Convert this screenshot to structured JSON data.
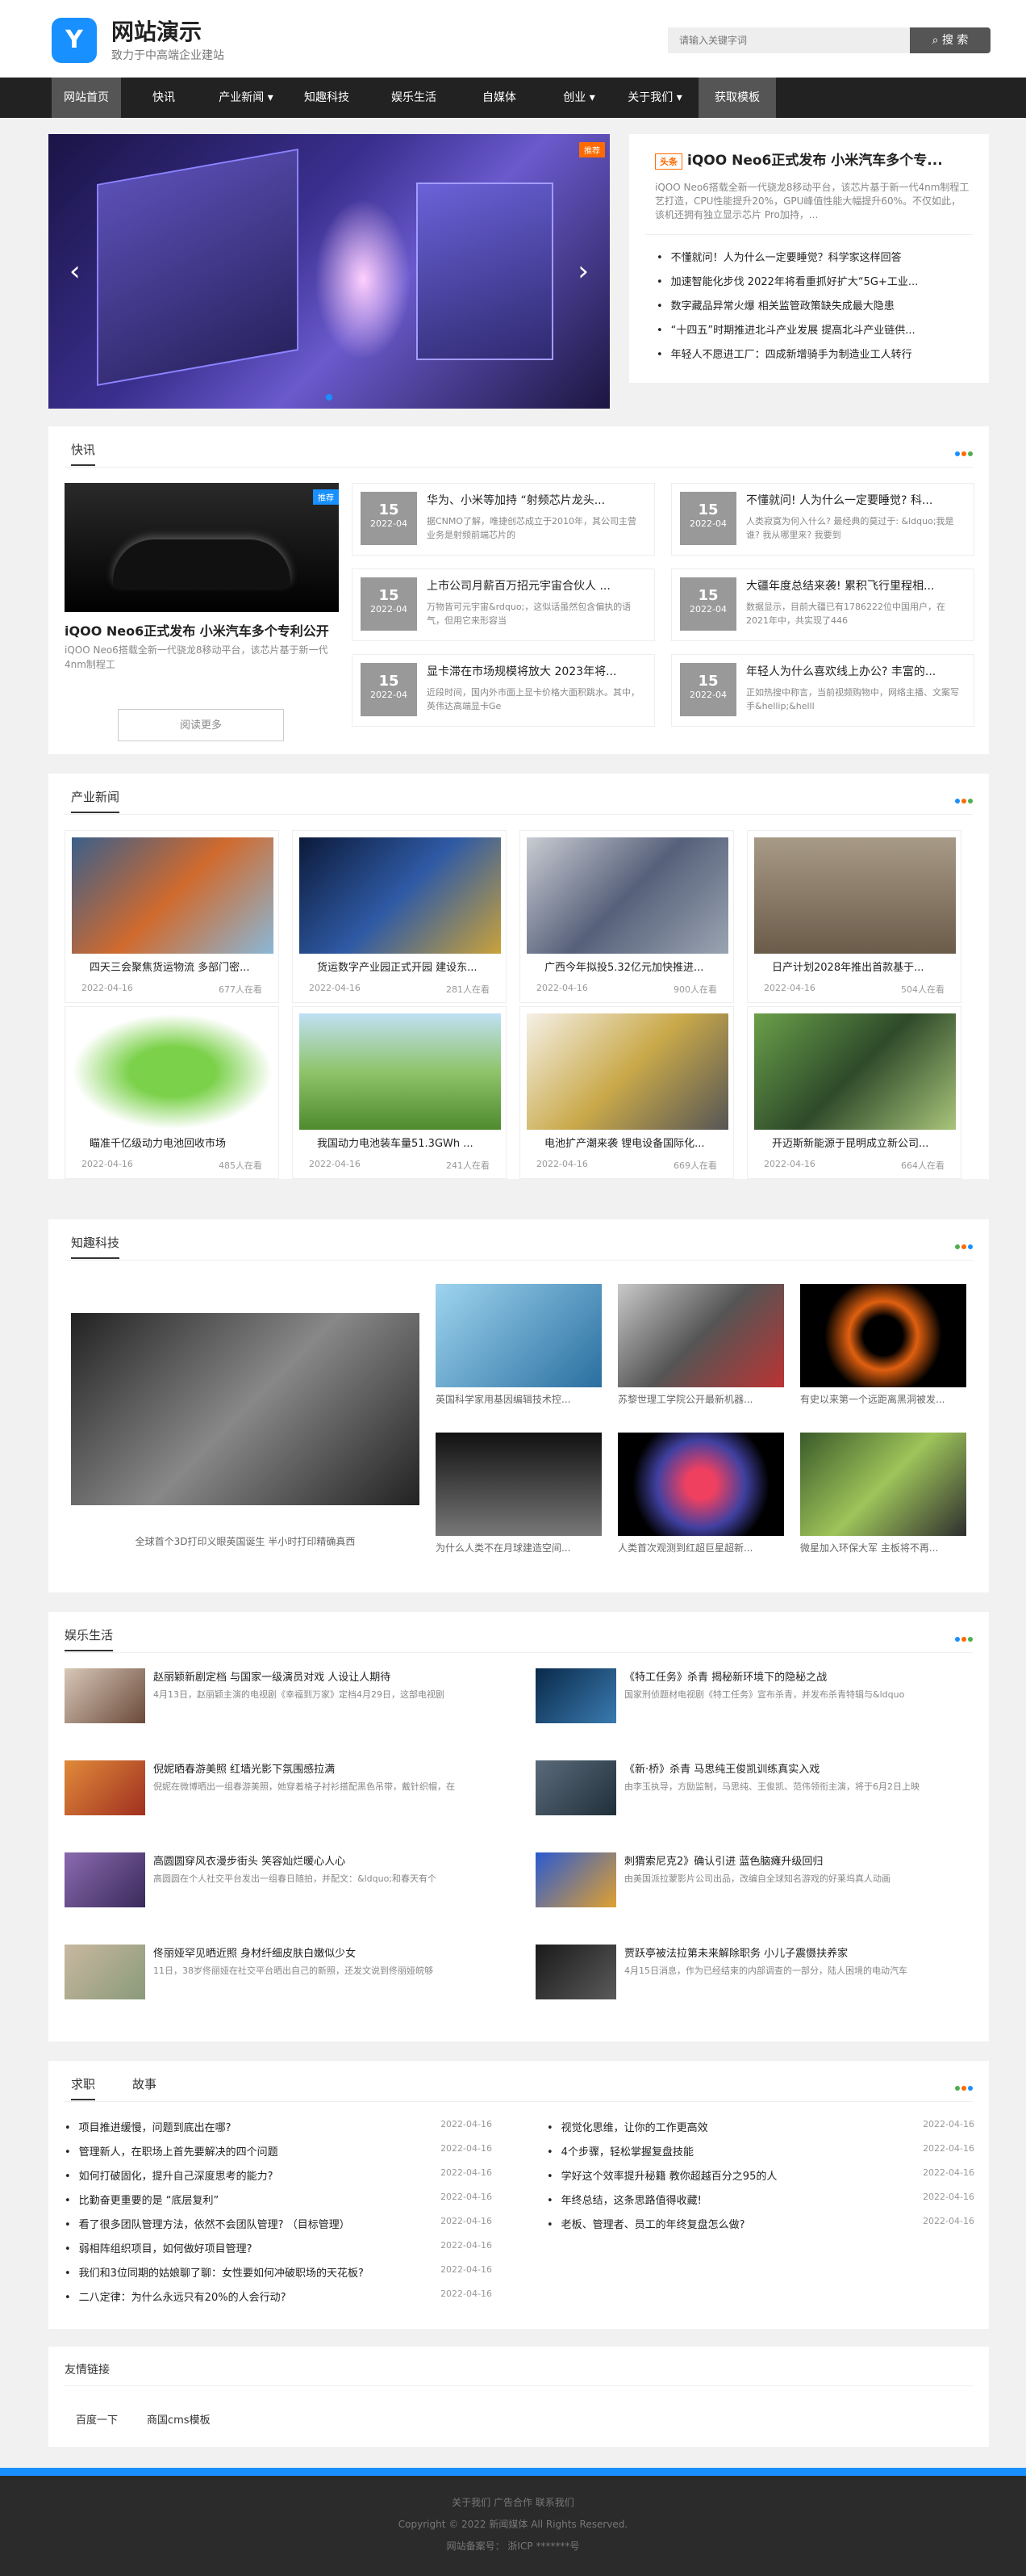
{
  "header": {
    "logo": "Y",
    "title": "网站演示",
    "subtitle": "致力于中高端企业建站",
    "search_placeholder": "请输入关键字词",
    "search_label": "搜 索"
  },
  "nav": [
    "网站首页",
    "快讯",
    "产业新闻 ▾",
    "知趣科技",
    "娱乐生活",
    "自媒体",
    "创业 ▾",
    "关于我们 ▾",
    "获取模板"
  ],
  "slider": {
    "badge": "推荐",
    "prev": "‹",
    "next": "›"
  },
  "featured": {
    "tag": "头条",
    "title": "iQOO Neo6正式发布 小米汽车多个专...",
    "desc": "iQOO Neo6搭载全新一代骁龙8移动平台，该芯片基于新一代4nm制程工艺打造，CPU性能提升20%，GPU峰值性能大幅提升60%。不仅如此，该机还拥有独立显示芯片 Pro加持，...",
    "list": [
      "不懂就问！人为什么一定要睡觉？科学家这样回答",
      "加速智能化步伐 2022年将看重抓好扩大“5G+工业...",
      "数字藏品异常火爆 相关监管政策缺失成最大隐患",
      "“十四五”时期推进北斗产业发展 提高北斗产业链供...",
      "年轻人不愿进工厂：四成新增骑手为制造业工人转行"
    ]
  },
  "kuaixun": {
    "title": "快讯",
    "feature_badge": "推荐",
    "feature_title": "iQOO Neo6正式发布 小米汽车多个专利公开",
    "feature_desc": "iQOO Neo6搭载全新一代骁龙8移动平台，该芯片基于新一代4nm制程工",
    "more": "阅读更多",
    "items": [
      {
        "day": "15",
        "ym": "2022-04",
        "t": "华为、小米等加持 “射频芯片龙头...",
        "d": "据CNMO了解，唯捷创芯成立于2010年，其公司主营业务是射频前端芯片的"
      },
      {
        "day": "15",
        "ym": "2022-04",
        "t": "不懂就问! 人为什么一定要睡觉? 科...",
        "d": "人类寂寞为何入什么? 最经典的莫过于: &ldquo;我是谁? 我从哪里来? 我要到"
      },
      {
        "day": "15",
        "ym": "2022-04",
        "t": "上市公司月薪百万招元宇宙合伙人 ...",
        "d": "万物皆可元宇宙&rdquo;，这似话虽然包含偏执的语气，但用它来形容当"
      },
      {
        "day": "15",
        "ym": "2022-04",
        "t": "大疆年度总结来袭! 累积飞行里程相...",
        "d": "数据显示，目前大疆已有1786222位中国用户，在2021年中，共实现了446"
      },
      {
        "day": "15",
        "ym": "2022-04",
        "t": "显卡滞在市场规模将放大 2023年将...",
        "d": "近段时间，国内外市面上显卡价格大面积跳水。其中，英伟达高端显卡Ge"
      },
      {
        "day": "15",
        "ym": "2022-04",
        "t": "年轻人为什么喜欢线上办公? 丰富的...",
        "d": "正如热搜中称言，当前视频购物中，网络主播、文案写手&hellip;&helll"
      }
    ]
  },
  "chanye": {
    "title": "产业新闻",
    "items": [
      {
        "t": "四天三会聚焦货运物流 多部门密...",
        "dt": "2022-04-16",
        "v": "677人在看"
      },
      {
        "t": "货运数字产业园正式开园 建设东...",
        "dt": "2022-04-16",
        "v": "281人在看"
      },
      {
        "t": "广西今年拟投5.32亿元加快推进...",
        "dt": "2022-04-16",
        "v": "900人在看"
      },
      {
        "t": "日产计划2028年推出首款基于...",
        "dt": "2022-04-16",
        "v": "504人在看"
      },
      {
        "t": "瞄准千亿级动力电池回收市场",
        "dt": "2022-04-16",
        "v": "485人在看"
      },
      {
        "t": "我国动力电池装车量51.3GWh ...",
        "dt": "2022-04-16",
        "v": "241人在看"
      },
      {
        "t": "电池扩产潮来袭 锂电设备国际化...",
        "dt": "2022-04-16",
        "v": "669人在看"
      },
      {
        "t": "开迈斯新能源于昆明成立新公司...",
        "dt": "2022-04-16",
        "v": "664人在看"
      }
    ]
  },
  "zhiqu": {
    "title": "知趣科技",
    "feature": "全球首个3D打印义眼英国诞生 半小时打印精确真西",
    "items": [
      "英国科学家用基因编辑技术控...",
      "苏黎世理工学院公开最新机器...",
      "有史以来第一个远距离黑洞被发...",
      "为什么人类不在月球建造空间...",
      "人类首次观测到红超巨星超新...",
      "微星加入环保大军 主板将不再..."
    ]
  },
  "yule": {
    "title": "娱乐生活",
    "items": [
      {
        "t": "赵丽颖新剧定档 与国家一级演员对戏 人设让人期待",
        "d": "4月13日，赵丽颖主演的电视剧《幸福到万家》定档4月29日，这部电视剧"
      },
      {
        "t": "《特工任务》杀青 揭秘新环境下的隐秘之战",
        "d": "国家刑侦题材电视剧《特工任务》宣布杀青，并发布杀青特辑与&ldquo"
      },
      {
        "t": "倪妮晒春游美照 红墙光影下氛围感拉满",
        "d": "倪妮在微博晒出一组春游美照，她穿着格子衬衫搭配黑色吊带，戴针织帽，在"
      },
      {
        "t": "《新·桥》杀青 马思纯王俊凯训练真实入戏",
        "d": "由李玉执导，方励监制，马思纯、王俊凯、范伟领衔主演，将于6月2日上映"
      },
      {
        "t": "高圆圆穿风衣漫步街头 笑容灿烂暖心人心",
        "d": "高圆圆在个人社交平台发出一组春日随拍，并配文：&ldquo;和春天有个"
      },
      {
        "t": "刺猬索尼克2》确认引进 蓝色脑瘫升级回归",
        "d": "由美国派拉蒙影片公司出品，改编自全球知名游戏的好莱坞真人动画"
      },
      {
        "t": "佟丽娅罕见晒近照 身材纤细皮肤白嫩似少女",
        "d": "11日，38岁佟丽娅在社交平台晒出自己的新照，还发文说到佟丽娅皖够"
      },
      {
        "t": "贾跃亭被法拉第未来解除职务 小儿子震慑扶养家",
        "d": "4月15日消息，作为已经结束的内部调查的一部分，陆人困境的电动汽车"
      }
    ]
  },
  "tabs": {
    "active": "求职",
    "other": "故事",
    "left": [
      {
        "t": "项目推进缓慢，问题到底出在哪?",
        "dt": "2022-04-16"
      },
      {
        "t": "管理新人，在职场上首先要解决的四个问题",
        "dt": "2022-04-16"
      },
      {
        "t": "如何打破固化，提升自己深度思考的能力?",
        "dt": "2022-04-16"
      },
      {
        "t": "比勤奋更重要的是 “底层复利”",
        "dt": "2022-04-16"
      },
      {
        "t": "看了很多团队管理方法，依然不会团队管理?  （目标管理）",
        "dt": "2022-04-16"
      },
      {
        "t": "弱相阵组织项目，如何做好项目管理?",
        "dt": "2022-04-16"
      },
      {
        "t": "我们和3位同期的姑娘聊了聊：女性要如何冲破职场的天花板?",
        "dt": "2022-04-16"
      },
      {
        "t": "二八定律：为什么永远只有20%的人会行动?",
        "dt": "2022-04-16"
      }
    ],
    "right": [
      {
        "t": "视觉化思维，让你的工作更高效",
        "dt": "2022-04-16"
      },
      {
        "t": "4个步骤，轻松掌握复盘技能",
        "dt": "2022-04-16"
      },
      {
        "t": "学好这个效率提升秘籍 教你超越百分之95的人",
        "dt": "2022-04-16"
      },
      {
        "t": "年终总结，这条思路值得收藏!",
        "dt": "2022-04-16"
      },
      {
        "t": "老板、管理者、员工的年终复盘怎么做?",
        "dt": "2022-04-16"
      }
    ]
  },
  "links": {
    "title": "友情链接",
    "items": [
      "百度一下",
      "商国cms模板"
    ]
  },
  "footer": {
    "l1": "关于我们 广告合作 联系我们",
    "l2": "Copyright © 2022 新闻媒体 All Rights Reserved.",
    "l3": "网站备案号：  浙ICP *******号"
  },
  "colors": {
    "accent": "#1890ff",
    "dot1": "#1890ff",
    "dot2": "#ff6a00",
    "dot3": "#4caf50"
  }
}
